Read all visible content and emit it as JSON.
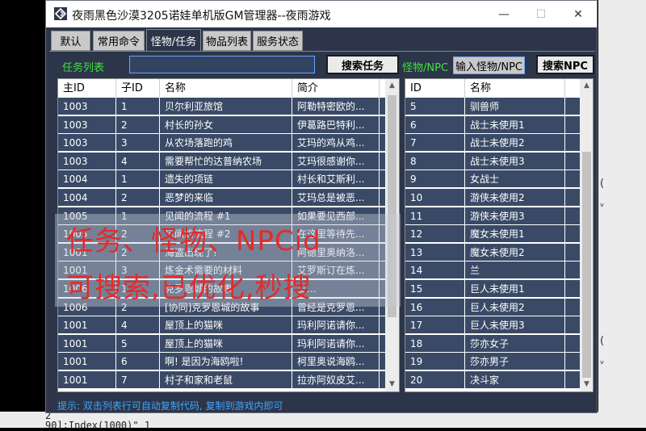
{
  "window": {
    "title": "夜雨黑色沙漠3205诺娃单机版GM管理器--夜雨游戏",
    "minimize": "—",
    "maximize": "☐",
    "close": "✕"
  },
  "tabs": [
    "默认",
    "常用命令",
    "怪物/任务",
    "物品列表",
    "服务状态"
  ],
  "active_tab": "怪物/任务",
  "quest": {
    "label": "任务列表",
    "search_value": "",
    "search_button": "搜索任务",
    "columns": [
      "主ID",
      "子ID",
      "名称",
      "简介"
    ],
    "rows": [
      [
        "1003",
        "1",
        "贝尔利亚旅馆",
        "阿勒特密欧的..."
      ],
      [
        "1003",
        "2",
        "村长的孙女",
        "伊葛路巴特利..."
      ],
      [
        "1003",
        "3",
        "从农场落跑的鸡",
        "艾玛的鸡从鸡..."
      ],
      [
        "1003",
        "4",
        "需要帮忙的达普纳农场",
        "艾玛很感谢你..."
      ],
      [
        "1004",
        "1",
        "遗失的项链",
        "村长和艾斯利..."
      ],
      [
        "1004",
        "2",
        "恶梦的来临",
        "艾玛总是被恶..."
      ],
      [
        "1005",
        "1",
        "见闻的流程 #1",
        "如果要见西部..."
      ],
      [
        "1005",
        "2",
        "见闻的流程 #2",
        "在这里等待先..."
      ],
      [
        "1001",
        "2",
        "海盗出现了!",
        "阿德里奥纳洛..."
      ],
      [
        "1001",
        "3",
        "炼金术需要的材料",
        "艾罗斯订在炼..."
      ],
      [
        "1006",
        "1",
        "克罗恩城的故事",
        "艾..."
      ],
      [
        "1006",
        "2",
        "[协同]克罗恩城的故事",
        "曾经是克罗恩..."
      ],
      [
        "1001",
        "4",
        "屋顶上的猫咪",
        "玛利阿诺请你..."
      ],
      [
        "1001",
        "5",
        "屋顶上的猫咪",
        "玛利阿诺请你..."
      ],
      [
        "1001",
        "6",
        "啊! 是因为海鸥啦!",
        "柯里奥说海鸥..."
      ],
      [
        "1001",
        "7",
        "村子和家和老鼠",
        "拉亦阿奴皮艾..."
      ]
    ]
  },
  "npc": {
    "label": "怪物/NPC",
    "input_value": "输入怪物/NPC",
    "search_button": "搜索NPC",
    "columns": [
      "ID",
      "名称"
    ],
    "rows": [
      [
        "5",
        "驯兽师"
      ],
      [
        "6",
        "战士未使用1"
      ],
      [
        "7",
        "战士未使用2"
      ],
      [
        "8",
        "战士未使用3"
      ],
      [
        "9",
        "女战士"
      ],
      [
        "10",
        "游侠未使用2"
      ],
      [
        "11",
        "游侠未使用3"
      ],
      [
        "12",
        "魔女未使用1"
      ],
      [
        "13",
        "魔女未使用2"
      ],
      [
        "14",
        "兰"
      ],
      [
        "15",
        "巨人未使用1"
      ],
      [
        "16",
        "巨人未使用2"
      ],
      [
        "17",
        "巨人未使用3"
      ],
      [
        "18",
        "莎亦女子"
      ],
      [
        "19",
        "莎亦男子"
      ],
      [
        "20",
        "决斗家"
      ]
    ]
  },
  "status_tip": "提示: 双击列表行可自动复制代码, 复制到游戏内即可",
  "overlay": {
    "line1": "任务、怪物、NPCid",
    "line2": "可搜索,已优化,秒搜"
  },
  "background": {
    "right_fragments": [
      "(",
      "ᵥ",
      "(",
      "ᵥ"
    ],
    "bottom_line1": "2",
    "bottom_line2": "90];Index(1000)\" 1"
  },
  "colors": {
    "window_bg": "#2c3549",
    "row_bg": "#3a4a66",
    "label_green": "#3fe03f",
    "tip_blue": "#3ea6ff",
    "overlay_red": "#e52a2a"
  }
}
